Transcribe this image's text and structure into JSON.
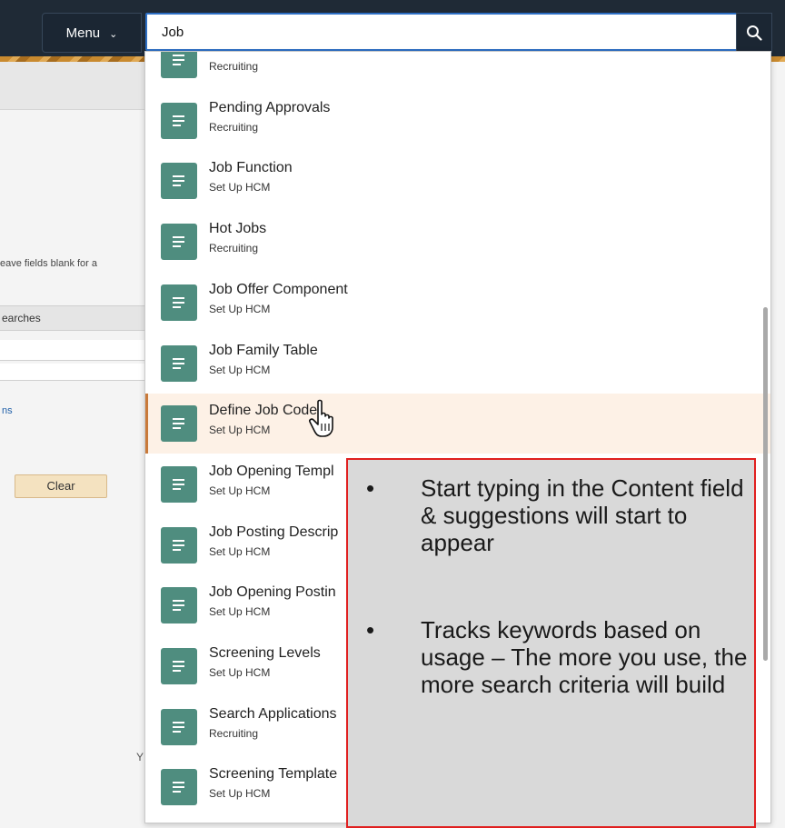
{
  "header": {
    "menu_label": "Menu",
    "search_value": "Job"
  },
  "background": {
    "hint_text": "eave fields blank for a",
    "searches_text": "earches",
    "link_text": "ns",
    "clear_label": "Clear",
    "stray_text": "Y"
  },
  "dropdown": {
    "items": [
      {
        "title": "",
        "subtitle": "Recruiting"
      },
      {
        "title": "Pending Approvals",
        "subtitle": "Recruiting"
      },
      {
        "title": "Job Function",
        "subtitle": "Set Up HCM"
      },
      {
        "title": "Hot Jobs",
        "subtitle": "Recruiting"
      },
      {
        "title": "Job Offer Component",
        "subtitle": "Set Up HCM"
      },
      {
        "title": "Job Family Table",
        "subtitle": "Set Up HCM"
      },
      {
        "title": "Define Job Code",
        "subtitle": "Set Up HCM"
      },
      {
        "title": "Job Opening Templ",
        "subtitle": "Set Up HCM"
      },
      {
        "title": "Job Posting Descrip",
        "subtitle": "Set Up HCM"
      },
      {
        "title": "Job Opening Postin",
        "subtitle": "Set Up HCM"
      },
      {
        "title": "Screening Levels",
        "subtitle": "Set Up HCM"
      },
      {
        "title": "Search Applications",
        "subtitle": "Recruiting"
      },
      {
        "title": "Screening Template",
        "subtitle": "Set Up HCM"
      }
    ],
    "highlighted_item": "Define Job Code"
  },
  "callout": {
    "bullets": [
      "Start typing in the Content field & suggestions will start to appear",
      "Tracks keywords based on usage – The more you use, the more search criteria will build"
    ],
    "bullet_symbol": "•"
  },
  "colors": {
    "topbar": "#1f2a36",
    "icon_tile": "#4f8d7f",
    "highlight_row": "#fdf1e6",
    "callout_border": "#e02020",
    "search_border": "#2d6fc4"
  }
}
